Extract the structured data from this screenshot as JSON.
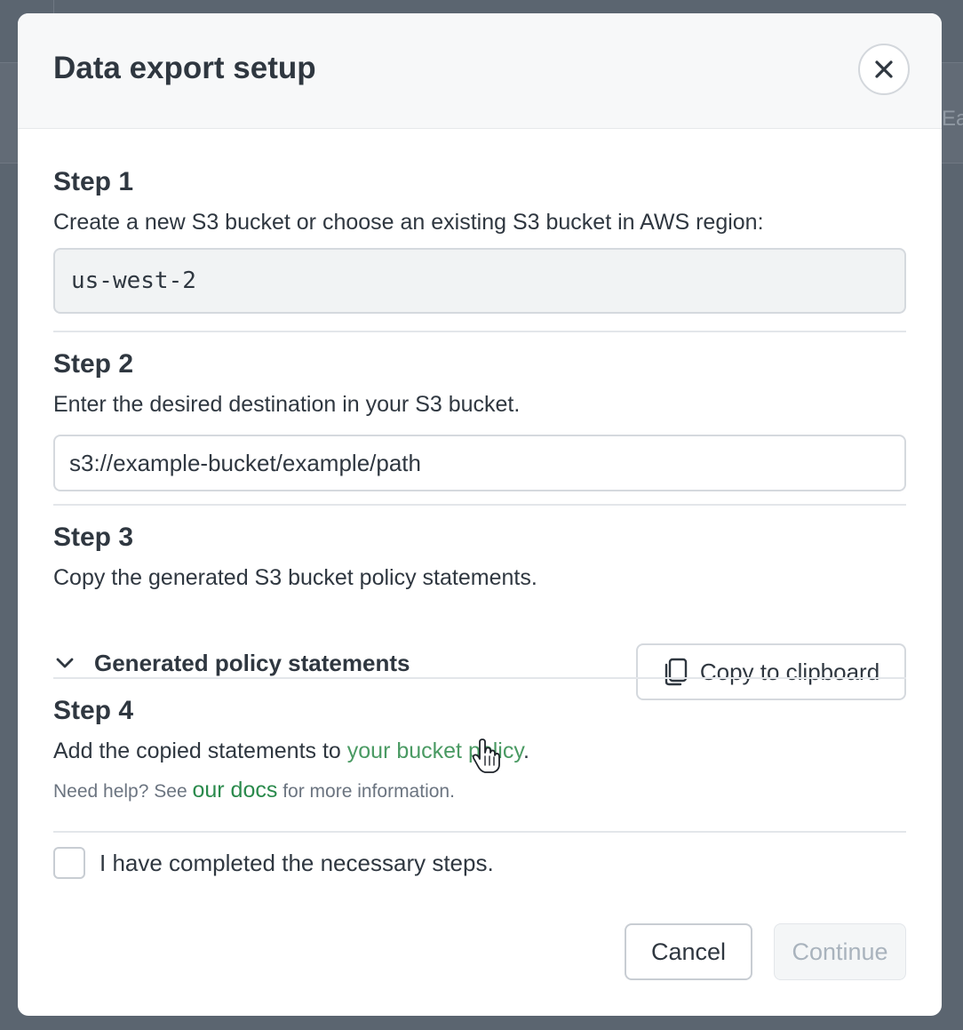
{
  "background": {
    "partial_text": "Ea"
  },
  "modal": {
    "title": "Data export setup",
    "close_icon": "close-icon"
  },
  "steps": [
    {
      "title": "Step 1",
      "description": "Create a new S3 bucket or choose an existing S3 bucket in AWS region:",
      "region_value": "us-west-2"
    },
    {
      "title": "Step 2",
      "description": "Enter the desired destination in your S3 bucket.",
      "destination_placeholder": "s3://example-bucket/example/path"
    },
    {
      "title": "Step 3",
      "description": "Copy the generated S3 bucket policy statements.",
      "disclosure_label": "Generated policy statements",
      "copy_button_label": "Copy to clipboard"
    },
    {
      "title": "Step 4",
      "description_prefix": "Add the copied statements to ",
      "description_link": "your bucket policy",
      "description_suffix": ".",
      "help_prefix": "Need help? See ",
      "help_link": "our docs",
      "help_suffix": " for more information."
    }
  ],
  "confirmation": {
    "checkbox_label": "I have completed the necessary steps.",
    "checked": false
  },
  "footer": {
    "cancel_label": "Cancel",
    "continue_label": "Continue",
    "continue_disabled": true
  },
  "colors": {
    "link": "#4a9a63",
    "overlay": "#5b6570",
    "disabled_text": "#a9b3bd"
  }
}
